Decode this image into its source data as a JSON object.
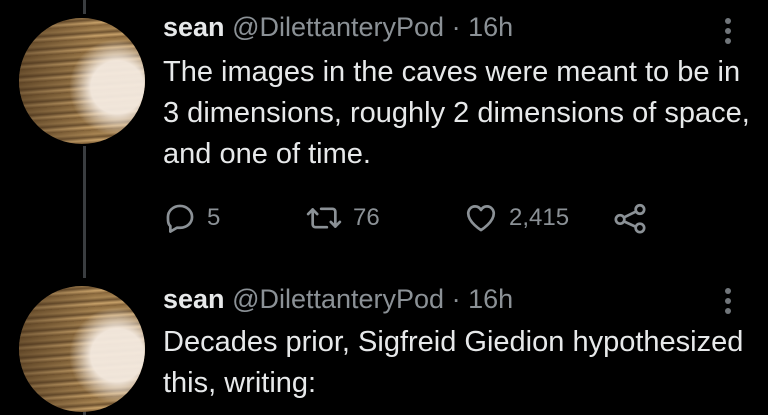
{
  "tweets": [
    {
      "name": "sean",
      "handle": "@DilettanteryPod",
      "separator": "·",
      "time": "16h",
      "text": "The images in the caves were meant to be in 3 dimensions, roughly 2 dimensions of space, and one of time.",
      "replies": "5",
      "retweets": "76",
      "likes": "2,415"
    },
    {
      "name": "sean",
      "handle": "@DilettanteryPod",
      "separator": "·",
      "time": "16h",
      "text": "Decades prior, Sigfreid Giedion hypothesized this, writing:"
    }
  ],
  "icons": {
    "reply": "reply-icon",
    "retweet": "retweet-icon",
    "like": "heart-icon",
    "share": "share-icon",
    "more": "more-vertical-icon"
  },
  "colors": {
    "background": "#000000",
    "text": "#e7e9ea",
    "secondary": "#8b9196",
    "thread_line": "#3a3d40"
  }
}
